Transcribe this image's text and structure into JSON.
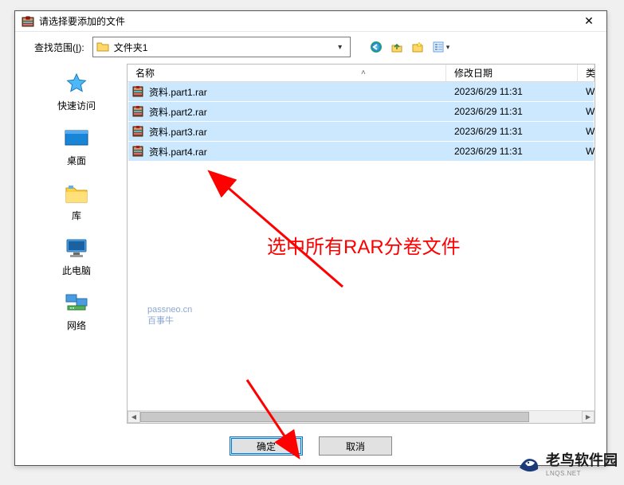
{
  "window": {
    "title": "请选择要添加的文件",
    "close_glyph": "✕"
  },
  "lookin": {
    "label_pre": "查找范围(",
    "label_key": "I",
    "label_post": "):",
    "folder_name": "文件夹1"
  },
  "places": [
    {
      "label": "快速访问",
      "icon": "star"
    },
    {
      "label": "桌面",
      "icon": "desktop"
    },
    {
      "label": "库",
      "icon": "libraries"
    },
    {
      "label": "此电脑",
      "icon": "computer"
    },
    {
      "label": "网络",
      "icon": "network"
    }
  ],
  "columns": {
    "name": "名称",
    "date": "修改日期",
    "type_initial": "类"
  },
  "files": [
    {
      "name": "资料.part1.rar",
      "date": "2023/6/29 11:31",
      "type_initial": "W"
    },
    {
      "name": "资料.part2.rar",
      "date": "2023/6/29 11:31",
      "type_initial": "W"
    },
    {
      "name": "资料.part3.rar",
      "date": "2023/6/29 11:31",
      "type_initial": "W"
    },
    {
      "name": "资料.part4.rar",
      "date": "2023/6/29 11:31",
      "type_initial": "W"
    }
  ],
  "buttons": {
    "ok": "确定",
    "cancel": "取消"
  },
  "watermark": {
    "line1": "passneo.cn",
    "line2": "百事牛"
  },
  "annotation": "选中所有RAR分卷文件",
  "brand": {
    "name": "老鸟软件园",
    "sub": "LNQS.NET"
  }
}
